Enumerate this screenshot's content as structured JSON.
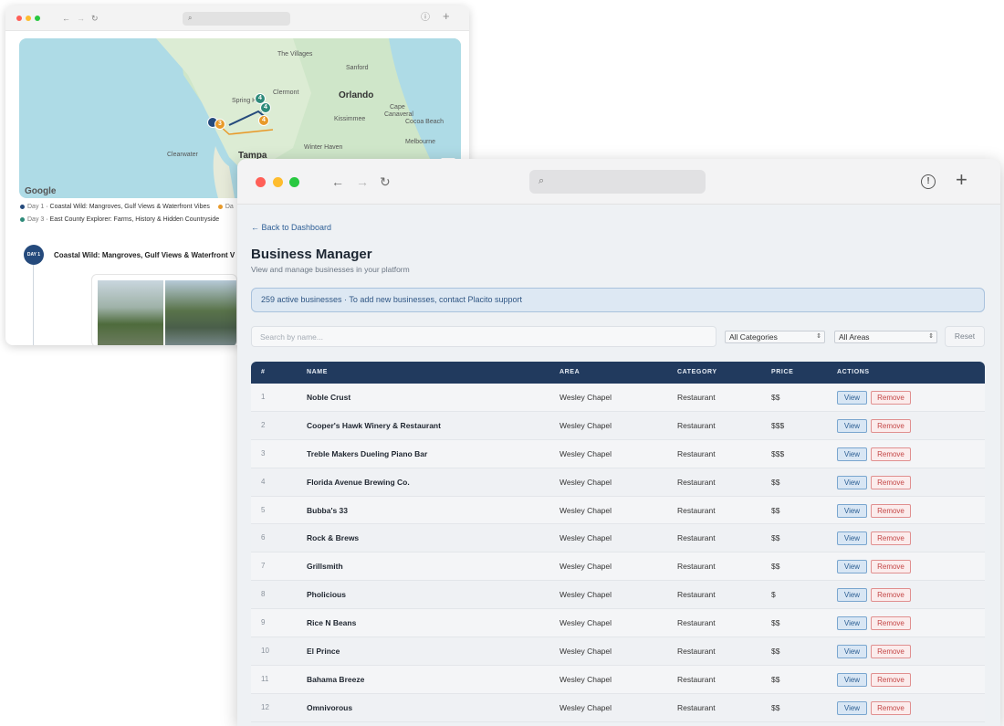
{
  "back_window": {
    "map": {
      "places": [
        "The Villages",
        "Sanford",
        "Orlando",
        "Clermont",
        "Spring H",
        "Kissimmee",
        "Cape",
        "Canaveral",
        "Cocoa Beach",
        "Clearwater",
        "Tampa",
        "Winter Haven",
        "Melbourne"
      ],
      "markers": [
        "4",
        "4",
        "3",
        "4"
      ],
      "zoom_in": "+",
      "attribution": "Google"
    },
    "legend": [
      {
        "label": "Day 1",
        "text": "Coastal Wild: Mangroves, Gulf Views & Waterfront Vibes",
        "color": "#254a7c"
      },
      {
        "label": "Da",
        "text": "",
        "color": "#e89a2a"
      },
      {
        "label": "Day 3",
        "text": "East County Explorer: Farms, History & Hidden Countryside",
        "color": "#2e8b7a"
      }
    ],
    "day_badge": "DAY 1",
    "day_title": "Coastal Wild: Mangroves, Gulf Views & Waterfront V"
  },
  "front_window": {
    "back_link": "← Back to Dashboard",
    "title": "Business Manager",
    "subtitle": "View and manage businesses in your platform",
    "notice": "259 active businesses · To add new businesses, contact Placito support",
    "search_placeholder": "Search by name...",
    "category_filter": "All Categories",
    "area_filter": "All Areas",
    "reset_label": "Reset",
    "columns": [
      "#",
      "NAME",
      "AREA",
      "CATEGORY",
      "PRICE",
      "ACTIONS"
    ],
    "view_label": "View",
    "remove_label": "Remove",
    "rows": [
      {
        "num": "1",
        "name": "Noble Crust",
        "area": "Wesley Chapel",
        "category": "Restaurant",
        "price": "$$"
      },
      {
        "num": "2",
        "name": "Cooper's Hawk Winery & Restaurant",
        "area": "Wesley Chapel",
        "category": "Restaurant",
        "price": "$$$"
      },
      {
        "num": "3",
        "name": "Treble Makers Dueling Piano Bar",
        "area": "Wesley Chapel",
        "category": "Restaurant",
        "price": "$$$"
      },
      {
        "num": "4",
        "name": "Florida Avenue Brewing Co.",
        "area": "Wesley Chapel",
        "category": "Restaurant",
        "price": "$$"
      },
      {
        "num": "5",
        "name": "Bubba's 33",
        "area": "Wesley Chapel",
        "category": "Restaurant",
        "price": "$$"
      },
      {
        "num": "6",
        "name": "Rock & Brews",
        "area": "Wesley Chapel",
        "category": "Restaurant",
        "price": "$$"
      },
      {
        "num": "7",
        "name": "Grillsmith",
        "area": "Wesley Chapel",
        "category": "Restaurant",
        "price": "$$"
      },
      {
        "num": "8",
        "name": "Pholicious",
        "area": "Wesley Chapel",
        "category": "Restaurant",
        "price": "$"
      },
      {
        "num": "9",
        "name": "Rice N Beans",
        "area": "Wesley Chapel",
        "category": "Restaurant",
        "price": "$$"
      },
      {
        "num": "10",
        "name": "El Prince",
        "area": "Wesley Chapel",
        "category": "Restaurant",
        "price": "$$"
      },
      {
        "num": "11",
        "name": "Bahama Breeze",
        "area": "Wesley Chapel",
        "category": "Restaurant",
        "price": "$$"
      },
      {
        "num": "12",
        "name": "Omnivorous",
        "area": "Wesley Chapel",
        "category": "Restaurant",
        "price": "$$"
      }
    ]
  }
}
